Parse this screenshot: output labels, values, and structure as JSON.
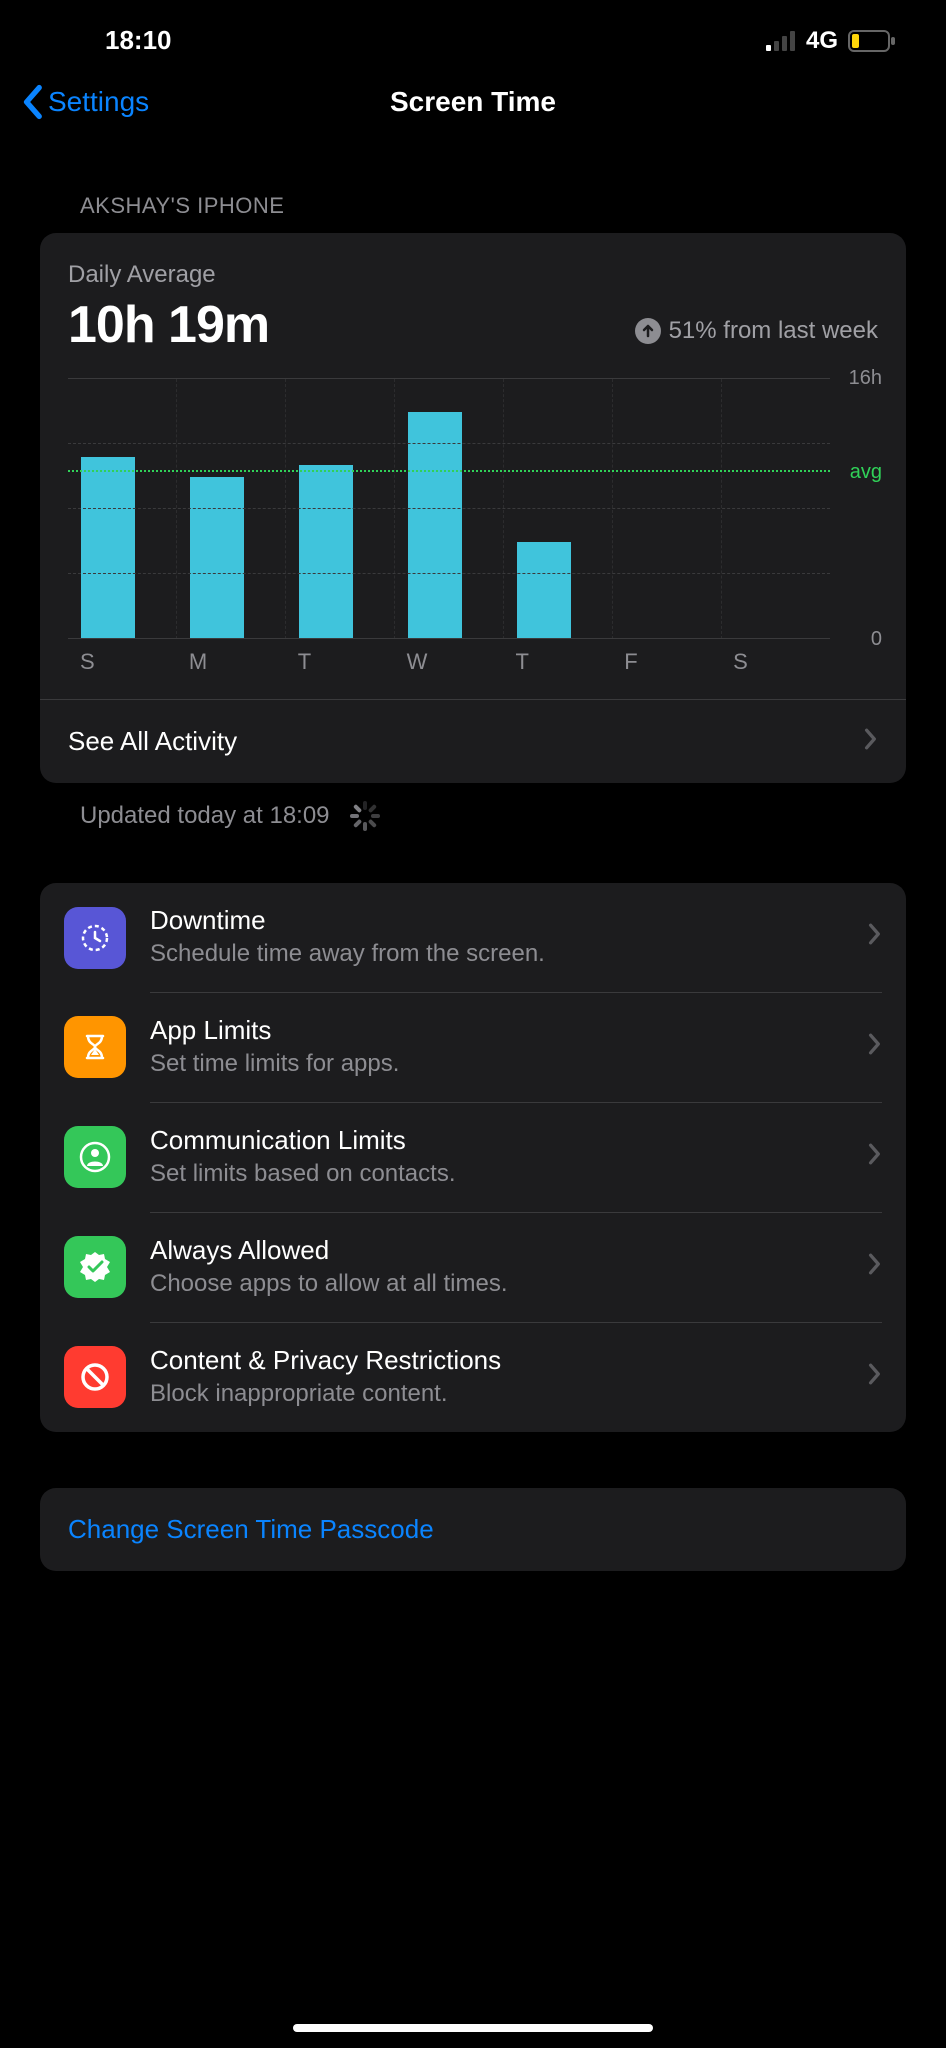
{
  "status": {
    "time": "18:10",
    "network": "4G"
  },
  "nav": {
    "back": "Settings",
    "title": "Screen Time"
  },
  "device_header": "AKSHAY'S IPHONE",
  "summary": {
    "label": "Daily Average",
    "value": "10h 19m",
    "delta": "51% from last week"
  },
  "chart_data": {
    "type": "bar",
    "categories": [
      "S",
      "M",
      "T",
      "W",
      "T",
      "F",
      "S"
    ],
    "values": [
      11.2,
      10.0,
      10.7,
      14.0,
      6.0,
      0,
      0
    ],
    "avg": 10.3,
    "ylim": [
      0,
      16
    ],
    "y_top_label": "16h",
    "y_bot_label": "0",
    "avg_label": "avg"
  },
  "see_all": "See All Activity",
  "updated": "Updated today at 18:09",
  "options": [
    {
      "title": "Downtime",
      "sub": "Schedule time away from the screen.",
      "icon": "clock-icon",
      "color": "ic-purple"
    },
    {
      "title": "App Limits",
      "sub": "Set time limits for apps.",
      "icon": "hourglass-icon",
      "color": "ic-orange"
    },
    {
      "title": "Communication Limits",
      "sub": "Set limits based on contacts.",
      "icon": "person-circle-icon",
      "color": "ic-green"
    },
    {
      "title": "Always Allowed",
      "sub": "Choose apps to allow at all times.",
      "icon": "checkmark-seal-icon",
      "color": "ic-green"
    },
    {
      "title": "Content & Privacy Restrictions",
      "sub": "Block inappropriate content.",
      "icon": "no-symbol-icon",
      "color": "ic-red"
    }
  ],
  "change_passcode": "Change Screen Time Passcode"
}
